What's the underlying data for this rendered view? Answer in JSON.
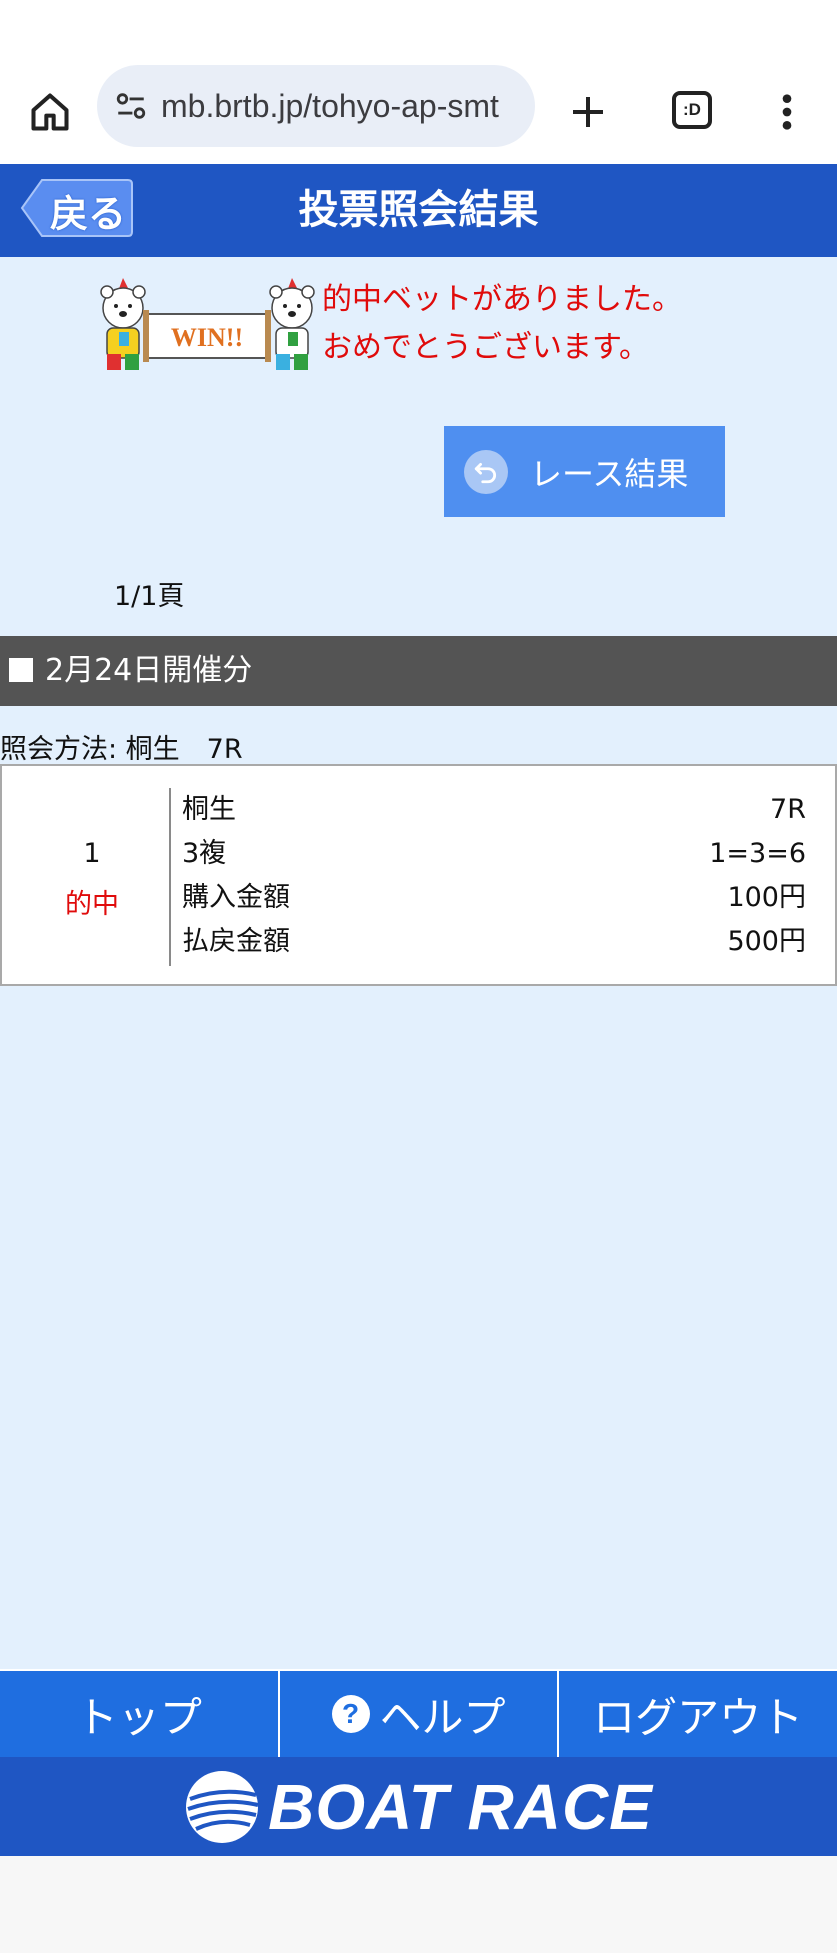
{
  "browser": {
    "url": "mb.brtb.jp/tohyo-ap-smt",
    "tabs_label": ":D"
  },
  "header": {
    "back_label": "戻る",
    "title": "投票照会結果"
  },
  "win_banner": {
    "image_text": "WIN!!",
    "line1": "的中ベットがありました。",
    "line2": "おめでとうございます。"
  },
  "race_result_button": {
    "label": "レース結果"
  },
  "page_count": "1/1頁",
  "date_section": {
    "label": "2月24日開催分"
  },
  "query_method": "照会方法: 桐生　7R",
  "result": {
    "number": "1",
    "status": "的中",
    "rows": [
      {
        "key": "桐生",
        "value": "7R"
      },
      {
        "key": "3複",
        "value": "1=3=6"
      },
      {
        "key": "購入金額",
        "value": "100円"
      },
      {
        "key": "払戻金額",
        "value": "500円"
      }
    ]
  },
  "bottom_nav": {
    "top": "トップ",
    "help": "ヘルプ",
    "logout": "ログアウト"
  },
  "footer": {
    "logo_text": "BOAT RACE"
  },
  "colors": {
    "header_blue": "#1f56c3",
    "nav_blue": "#1f6ee0",
    "page_bg": "#e3f0fd",
    "hit_red": "#e00b0b"
  }
}
